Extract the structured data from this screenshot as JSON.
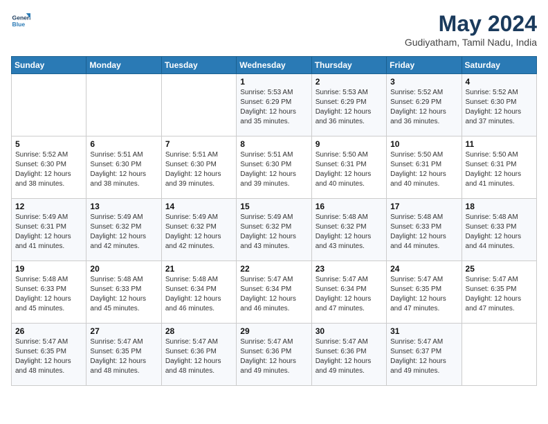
{
  "header": {
    "logo_line1": "General",
    "logo_line2": "Blue",
    "title": "May 2024",
    "subtitle": "Gudiyatham, Tamil Nadu, India"
  },
  "days_of_week": [
    "Sunday",
    "Monday",
    "Tuesday",
    "Wednesday",
    "Thursday",
    "Friday",
    "Saturday"
  ],
  "weeks": [
    [
      {
        "day": "",
        "info": ""
      },
      {
        "day": "",
        "info": ""
      },
      {
        "day": "",
        "info": ""
      },
      {
        "day": "1",
        "info": "Sunrise: 5:53 AM\nSunset: 6:29 PM\nDaylight: 12 hours\nand 35 minutes."
      },
      {
        "day": "2",
        "info": "Sunrise: 5:53 AM\nSunset: 6:29 PM\nDaylight: 12 hours\nand 36 minutes."
      },
      {
        "day": "3",
        "info": "Sunrise: 5:52 AM\nSunset: 6:29 PM\nDaylight: 12 hours\nand 36 minutes."
      },
      {
        "day": "4",
        "info": "Sunrise: 5:52 AM\nSunset: 6:30 PM\nDaylight: 12 hours\nand 37 minutes."
      }
    ],
    [
      {
        "day": "5",
        "info": "Sunrise: 5:52 AM\nSunset: 6:30 PM\nDaylight: 12 hours\nand 38 minutes."
      },
      {
        "day": "6",
        "info": "Sunrise: 5:51 AM\nSunset: 6:30 PM\nDaylight: 12 hours\nand 38 minutes."
      },
      {
        "day": "7",
        "info": "Sunrise: 5:51 AM\nSunset: 6:30 PM\nDaylight: 12 hours\nand 39 minutes."
      },
      {
        "day": "8",
        "info": "Sunrise: 5:51 AM\nSunset: 6:30 PM\nDaylight: 12 hours\nand 39 minutes."
      },
      {
        "day": "9",
        "info": "Sunrise: 5:50 AM\nSunset: 6:31 PM\nDaylight: 12 hours\nand 40 minutes."
      },
      {
        "day": "10",
        "info": "Sunrise: 5:50 AM\nSunset: 6:31 PM\nDaylight: 12 hours\nand 40 minutes."
      },
      {
        "day": "11",
        "info": "Sunrise: 5:50 AM\nSunset: 6:31 PM\nDaylight: 12 hours\nand 41 minutes."
      }
    ],
    [
      {
        "day": "12",
        "info": "Sunrise: 5:49 AM\nSunset: 6:31 PM\nDaylight: 12 hours\nand 41 minutes."
      },
      {
        "day": "13",
        "info": "Sunrise: 5:49 AM\nSunset: 6:32 PM\nDaylight: 12 hours\nand 42 minutes."
      },
      {
        "day": "14",
        "info": "Sunrise: 5:49 AM\nSunset: 6:32 PM\nDaylight: 12 hours\nand 42 minutes."
      },
      {
        "day": "15",
        "info": "Sunrise: 5:49 AM\nSunset: 6:32 PM\nDaylight: 12 hours\nand 43 minutes."
      },
      {
        "day": "16",
        "info": "Sunrise: 5:48 AM\nSunset: 6:32 PM\nDaylight: 12 hours\nand 43 minutes."
      },
      {
        "day": "17",
        "info": "Sunrise: 5:48 AM\nSunset: 6:33 PM\nDaylight: 12 hours\nand 44 minutes."
      },
      {
        "day": "18",
        "info": "Sunrise: 5:48 AM\nSunset: 6:33 PM\nDaylight: 12 hours\nand 44 minutes."
      }
    ],
    [
      {
        "day": "19",
        "info": "Sunrise: 5:48 AM\nSunset: 6:33 PM\nDaylight: 12 hours\nand 45 minutes."
      },
      {
        "day": "20",
        "info": "Sunrise: 5:48 AM\nSunset: 6:33 PM\nDaylight: 12 hours\nand 45 minutes."
      },
      {
        "day": "21",
        "info": "Sunrise: 5:48 AM\nSunset: 6:34 PM\nDaylight: 12 hours\nand 46 minutes."
      },
      {
        "day": "22",
        "info": "Sunrise: 5:47 AM\nSunset: 6:34 PM\nDaylight: 12 hours\nand 46 minutes."
      },
      {
        "day": "23",
        "info": "Sunrise: 5:47 AM\nSunset: 6:34 PM\nDaylight: 12 hours\nand 47 minutes."
      },
      {
        "day": "24",
        "info": "Sunrise: 5:47 AM\nSunset: 6:35 PM\nDaylight: 12 hours\nand 47 minutes."
      },
      {
        "day": "25",
        "info": "Sunrise: 5:47 AM\nSunset: 6:35 PM\nDaylight: 12 hours\nand 47 minutes."
      }
    ],
    [
      {
        "day": "26",
        "info": "Sunrise: 5:47 AM\nSunset: 6:35 PM\nDaylight: 12 hours\nand 48 minutes."
      },
      {
        "day": "27",
        "info": "Sunrise: 5:47 AM\nSunset: 6:35 PM\nDaylight: 12 hours\nand 48 minutes."
      },
      {
        "day": "28",
        "info": "Sunrise: 5:47 AM\nSunset: 6:36 PM\nDaylight: 12 hours\nand 48 minutes."
      },
      {
        "day": "29",
        "info": "Sunrise: 5:47 AM\nSunset: 6:36 PM\nDaylight: 12 hours\nand 49 minutes."
      },
      {
        "day": "30",
        "info": "Sunrise: 5:47 AM\nSunset: 6:36 PM\nDaylight: 12 hours\nand 49 minutes."
      },
      {
        "day": "31",
        "info": "Sunrise: 5:47 AM\nSunset: 6:37 PM\nDaylight: 12 hours\nand 49 minutes."
      },
      {
        "day": "",
        "info": ""
      }
    ]
  ]
}
